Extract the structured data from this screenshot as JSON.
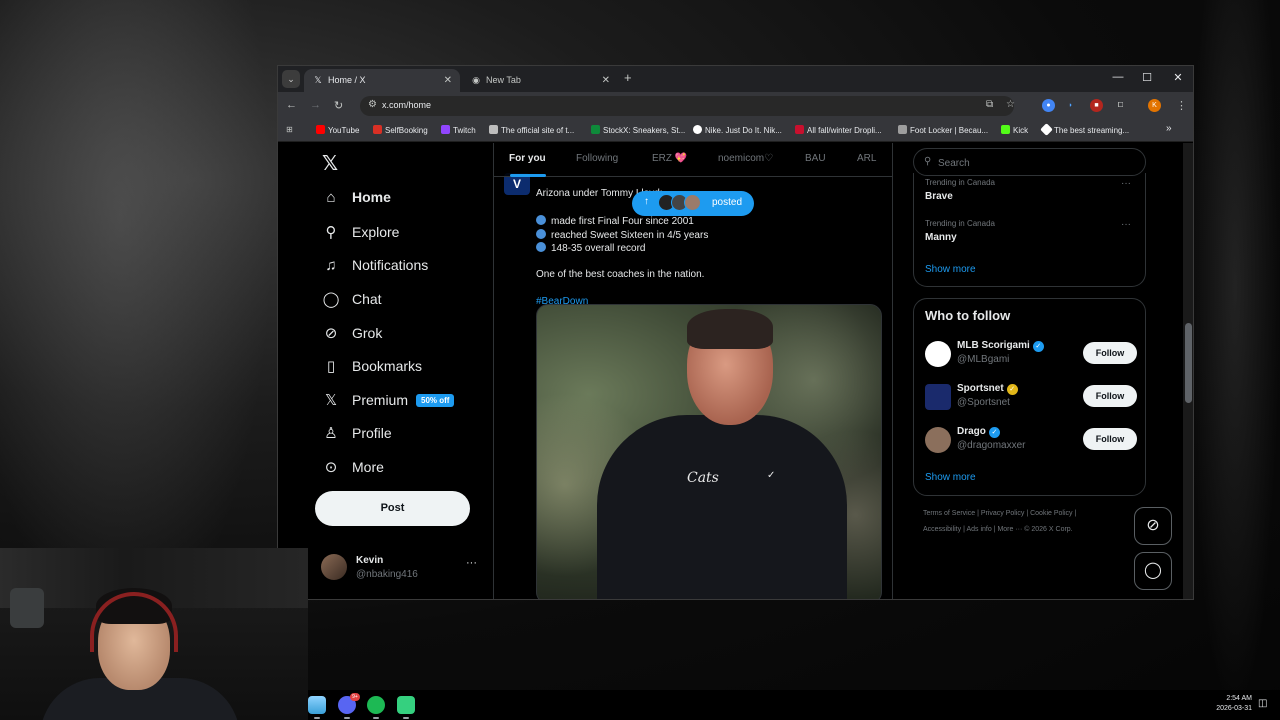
{
  "browser": {
    "tabs": [
      {
        "title": "Home / X",
        "icon": "x-logo-icon",
        "active": true
      },
      {
        "title": "New Tab",
        "icon": "chrome-icon",
        "active": false
      }
    ],
    "url": "x.com/home",
    "profile_initial": "K",
    "bookmarks": [
      {
        "label": "YouTube",
        "color": "#ff0000"
      },
      {
        "label": "SelfBooking",
        "color": "#d93025"
      },
      {
        "label": "Twitch",
        "color": "#9146ff"
      },
      {
        "label": "The official site of t...",
        "color": "#bdbdbd"
      },
      {
        "label": "StockX: Sneakers, St...",
        "color": "#0e8a3a"
      },
      {
        "label": "Nike. Just Do It. Nik...",
        "color": "#ffffff"
      },
      {
        "label": "All fall/winter Dropli...",
        "color": "#c8102e"
      },
      {
        "label": "Foot Locker | Becau...",
        "color": "#9e9e9e"
      },
      {
        "label": "Kick",
        "color": "#53fc18"
      },
      {
        "label": "The best streaming...",
        "color": "#ffffff"
      }
    ],
    "more_bookmarks": "»"
  },
  "nav": {
    "items": [
      {
        "label": "Home",
        "icon": "home-icon",
        "glyph": "⌂"
      },
      {
        "label": "Explore",
        "icon": "search-icon",
        "glyph": "⚲"
      },
      {
        "label": "Notifications",
        "icon": "bell-icon",
        "glyph": "🔔"
      },
      {
        "label": "Chat",
        "icon": "chat-icon",
        "glyph": "◯"
      },
      {
        "label": "Grok",
        "icon": "grok-icon",
        "glyph": "⊘"
      },
      {
        "label": "Bookmarks",
        "icon": "bookmark-icon",
        "glyph": "▯"
      },
      {
        "label": "Premium",
        "icon": "x-icon",
        "glyph": "𝕏"
      },
      {
        "label": "Profile",
        "icon": "person-icon",
        "glyph": "♙"
      },
      {
        "label": "More",
        "icon": "more-circle-icon",
        "glyph": "⊙"
      }
    ],
    "premium_badge": "50% off",
    "post_label": "Post"
  },
  "account": {
    "name": "Kevin",
    "handle": "@nbaking416",
    "more": "···"
  },
  "feed": {
    "tabs": [
      "For you",
      "Following",
      "ERZ 💖",
      "noemicom♡",
      "BAU",
      "ARL"
    ],
    "posted_label": "posted",
    "tweet": {
      "avatar_letter": "V",
      "line1": "Arizona under Tommy Lloyd:",
      "bullets": [
        "made first Final Four since 2001",
        "reached Sweet Sixteen in 4/5 years",
        "148-35 overall record"
      ],
      "line2": "One of the best coaches in the nation.",
      "hashtag": "#BearDown",
      "image_logo": "Cats"
    }
  },
  "sidebar": {
    "search_placeholder": "Search",
    "trends": [
      {
        "meta": "Trending in Canada",
        "name": "Brave"
      },
      {
        "meta": "Trending in Canada",
        "name": "Manny"
      }
    ],
    "trends_show_more": "Show more",
    "who_to_follow": {
      "title": "Who to follow",
      "accounts": [
        {
          "name": "MLB Scorigami",
          "handle": "@MLBgami",
          "verified_color": "#1d9bf0",
          "avatar_color": "#ffffff"
        },
        {
          "name": "Sportsnet",
          "handle": "@Sportsnet",
          "verified_color": "#e2b719",
          "avatar_color": "#1a2a6c"
        },
        {
          "name": "Drago",
          "handle": "@dragomaxxer",
          "verified_color": "#1d9bf0",
          "avatar_color": "#8b6f5c"
        }
      ],
      "follow_label": "Follow",
      "show_more": "Show more"
    },
    "footer_line1": "Terms of Service  |  Privacy Policy  |  Cookie Policy  |",
    "footer_line2": "Accessibility  |  Ads info  |  More ···  © 2026 X Corp."
  },
  "taskbar": {
    "time": "2:54 AM",
    "date": "2026-03-31",
    "discord_badge": "9+"
  }
}
